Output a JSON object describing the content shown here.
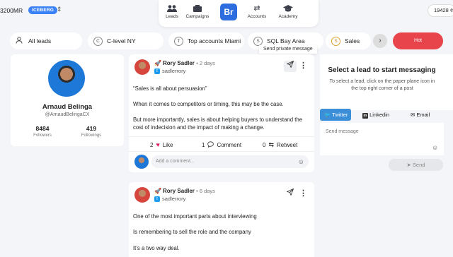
{
  "header": {
    "mrr": "3200MR",
    "plan_badge": "ICEBERG",
    "credits": "19428 ¢",
    "nav": [
      {
        "label": "Leads",
        "icon": "users-icon"
      },
      {
        "label": "Campaigns",
        "icon": "megaphone-icon"
      },
      {
        "label": "Br",
        "icon": "brand-logo"
      },
      {
        "label": "Accounts",
        "icon": "swap-icon"
      },
      {
        "label": "Academy",
        "icon": "graduation-cap-icon"
      }
    ]
  },
  "filters": {
    "all_leads": "All leads",
    "lists": [
      {
        "letter": "C",
        "label": "C-level NY"
      },
      {
        "letter": "T",
        "label": "Top accounts Miami"
      },
      {
        "letter": "S",
        "label": "SQL Bay Area"
      },
      {
        "letter": "S",
        "label": "Sales"
      }
    ],
    "hot": "Hot",
    "tooltip": "Send private message"
  },
  "profile": {
    "name": "Arnaud Belinga",
    "handle": "@ArnaudBelingaCX",
    "followers_count": "8484",
    "followers_label": "Followers",
    "followings_count": "419",
    "followings_label": "Followings"
  },
  "posts": [
    {
      "author": "Rory Sadler",
      "ago": "2 days",
      "handle": "sadlerrory",
      "paragraphs": [
        "“Sales is all about persuasion”",
        "When it comes to competitors or timing, this may be the case.",
        "But more importantly, sales is about helping buyers to understand the cost of indecision and the impact of making a change."
      ],
      "likes": "2",
      "like_label": "Like",
      "comments": "1",
      "comment_label": "Comment",
      "retweets": "0",
      "retweet_label": "Retweet",
      "comment_placeholder": "Add a comment..."
    },
    {
      "author": "Rory Sadler",
      "ago": "6 days",
      "handle": "sadlerrory",
      "paragraphs": [
        "One of the most important parts about interviewing",
        "Is remembering to sell the role and the company",
        "It’s a two way deal."
      ]
    }
  ],
  "messaging": {
    "title": "Select a lead to start messaging",
    "subtitle": "To select a lead, click on the paper plane icon in the top right corner of a post",
    "tabs": [
      {
        "label": "Twitter",
        "active": true
      },
      {
        "label": "Linkedin",
        "active": false
      },
      {
        "label": "Email",
        "active": false
      }
    ],
    "placeholder": "Send message",
    "send": "Send"
  },
  "colors": {
    "accent": "#2d6cdf",
    "hot": "#e8444b",
    "twitter": "#3b8ed8",
    "heart": "#e0245e"
  }
}
